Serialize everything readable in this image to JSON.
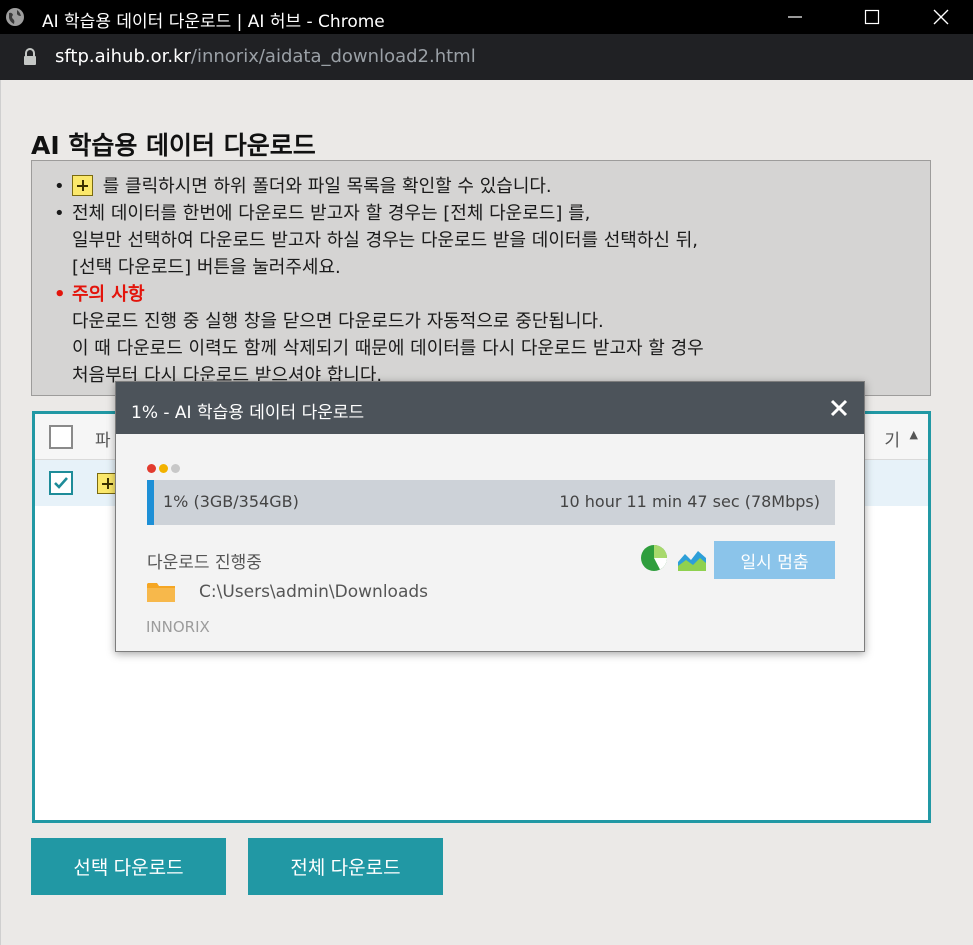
{
  "window": {
    "title": "AI 학습용 데이터 다운로드 | AI 허브 - Chrome",
    "minimize_label": "minimize",
    "maximize_label": "maximize",
    "close_label": "close"
  },
  "address_bar": {
    "host": "sftp.aihub.or.kr",
    "path": "/innorix/aidata_download2.html"
  },
  "page": {
    "title": "AI 학습용 데이터 다운로드",
    "notice": {
      "bullet": "•",
      "line1_suffix": " 를 클릭하시면 하위 폴더와 파일 목록을 확인할 수 있습니다.",
      "line2": "전체 데이터를 한번에 다운로드 받고자 할 경우는 [전체 다운로드] 를,",
      "line3": "일부만 선택하여 다운로드 받고자 하실 경우는 다운로드 받을 데이터를 선택하신 뒤,",
      "line4": "[선택 다운로드] 버튼을 눌러주세요.",
      "caution_title": "주의 사항",
      "caution_line1": "다운로드 진행 중 실행 창을 닫으면 다운로드가 자동적으로 중단됩니다.",
      "caution_line2": "이 때 다운로드 이력도 함께 삭제되기 때문에 데이터를 다시 다운로드 받고자 할 경우",
      "caution_line3": "처음부터 다시 다운로드 받으셔야 합니다."
    },
    "file_list": {
      "header_name": "파",
      "header_right": "기",
      "sort_indicator": "▲"
    },
    "buttons": {
      "select_download": "선택 다운로드",
      "all_download": "전체 다운로드"
    }
  },
  "dialog": {
    "title": "1% - AI 학습용 데이터 다운로드",
    "progress_percent": 1,
    "progress_left": "1% (3GB/354GB)",
    "progress_right": "10 hour 11 min 47 sec (78Mbps)",
    "status": "다운로드 진행중",
    "pause_label": "일시 멈춤",
    "path": "C:\\Users\\admin\\Downloads",
    "brand": "INNORIX",
    "dot_colors": [
      "#e23b2e",
      "#f2b200",
      "#c8c8c8"
    ],
    "accent": "#1d8fd6"
  },
  "colors": {
    "teal": "#2198a4",
    "caution_red": "#e3140b"
  }
}
